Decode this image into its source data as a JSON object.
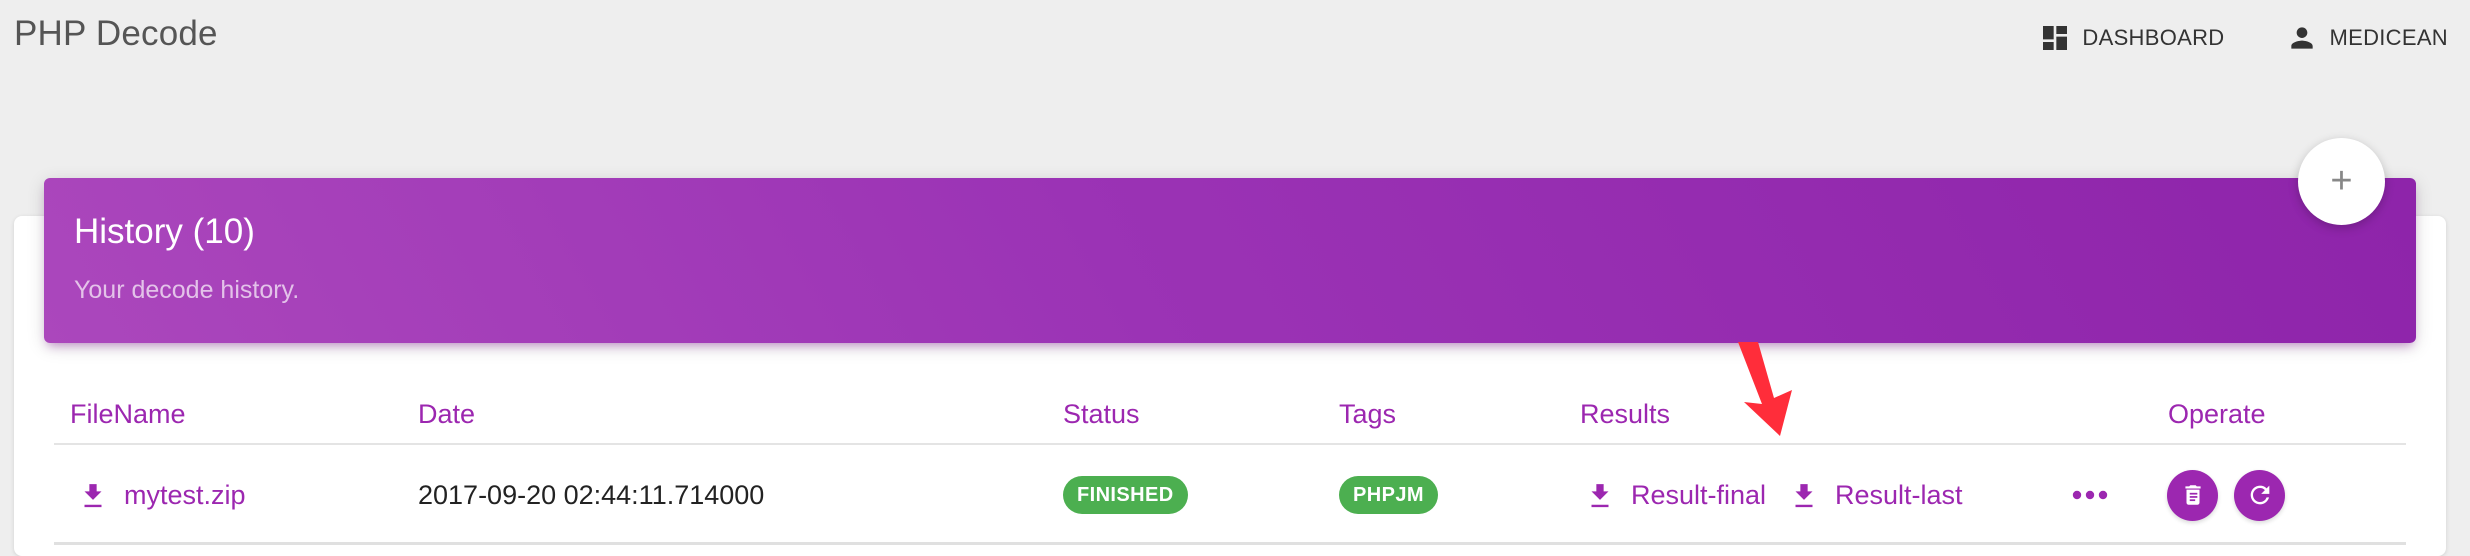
{
  "app": {
    "title": "PHP Decode"
  },
  "nav": {
    "dashboard": {
      "label": "DASHBOARD",
      "icon": "dashboard-icon"
    },
    "user": {
      "label": "MEDICEAN",
      "icon": "person-icon"
    }
  },
  "card": {
    "title": "History (10)",
    "subtitle": "Your decode history.",
    "add_button": {
      "label": "+",
      "icon": "plus-icon"
    }
  },
  "table": {
    "columns": [
      "FileName",
      "Date",
      "Status",
      "Tags",
      "Results",
      "Operate"
    ],
    "rows": [
      {
        "filename": "mytest.zip",
        "date": "2017-09-20 02:44:11.714000",
        "status": "FINISHED",
        "tag": "PHPJM",
        "results": [
          "Result-final",
          "Result-last"
        ],
        "more_icon": "more-horizontal-icon",
        "operations": [
          "delete-icon",
          "refresh-icon"
        ]
      }
    ]
  },
  "colors": {
    "primary": "#9c27b0",
    "success": "#4caf50",
    "annotation": "#ff2d3a"
  }
}
